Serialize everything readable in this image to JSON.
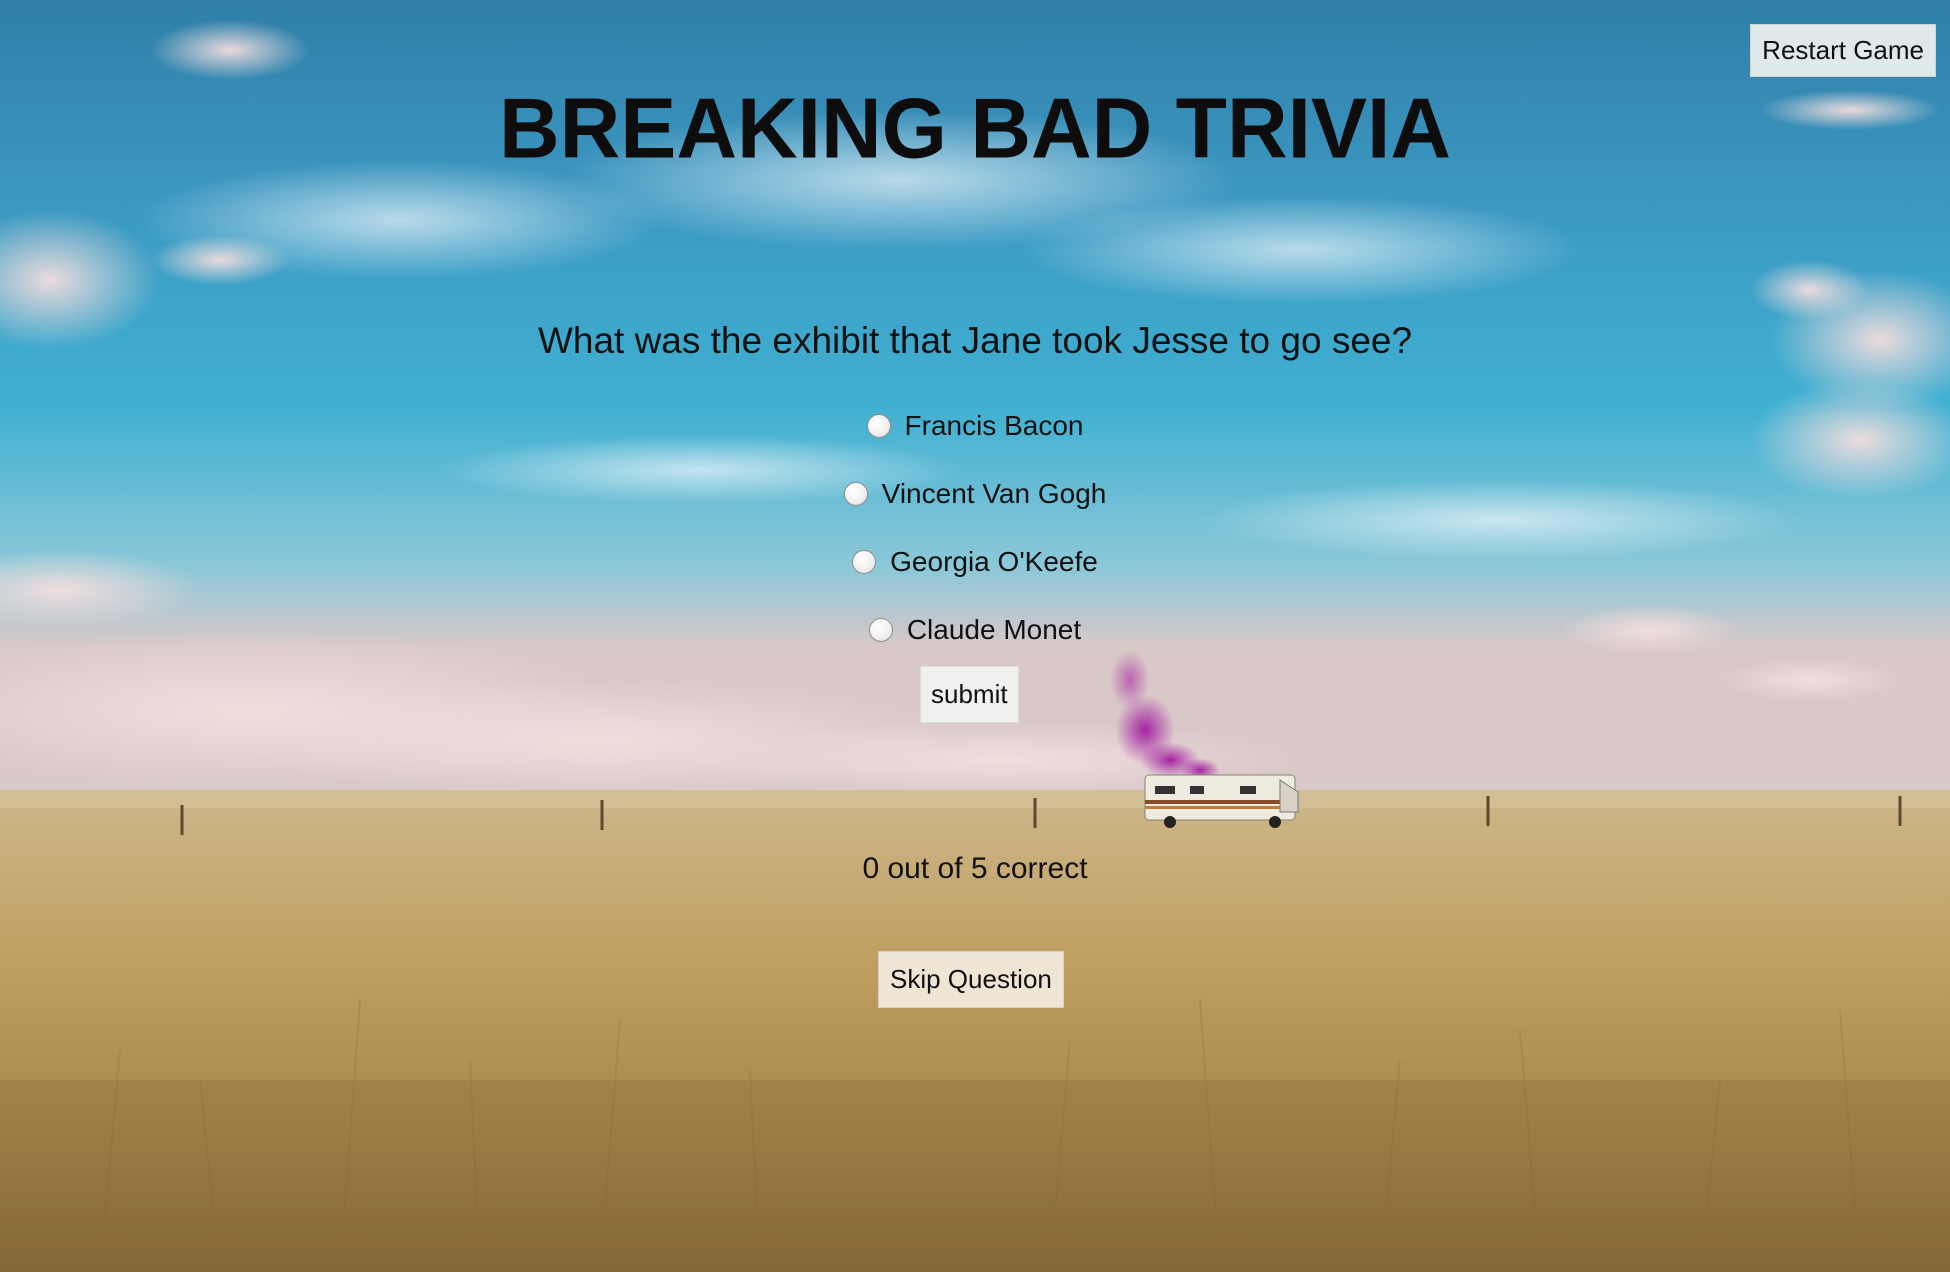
{
  "header": {
    "restart_label": "Restart Game",
    "title": "BREAKING BAD TRIVIA"
  },
  "quiz": {
    "question": "What was the exhibit that Jane took Jesse to go see?",
    "options": [
      {
        "label": "Francis Bacon",
        "selected": false
      },
      {
        "label": "Vincent Van Gogh",
        "selected": false
      },
      {
        "label": "Georgia O'Keefe",
        "selected": false
      },
      {
        "label": "Claude Monet",
        "selected": false
      }
    ],
    "submit_label": "submit",
    "score_text": "0 out of 5 correct",
    "skip_label": "Skip Question"
  },
  "background": {
    "scene": "desert-sky-rv-icon",
    "sky_color": "#2f9ccc",
    "grass_color": "#b89a5c",
    "smoke_color": "#a01aa0"
  }
}
